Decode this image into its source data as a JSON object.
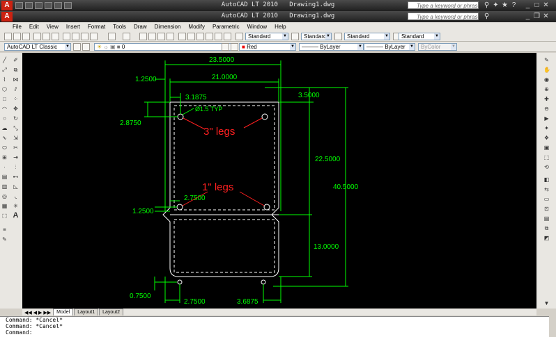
{
  "app": {
    "title": "AutoCAD LT 2010",
    "document": "Drawing1.dwg"
  },
  "search": {
    "placeholder": "Type a keyword or phrase"
  },
  "menu": [
    "File",
    "Edit",
    "View",
    "Insert",
    "Format",
    "Tools",
    "Draw",
    "Dimension",
    "Modify",
    "Parametric",
    "Window",
    "Help"
  ],
  "toolbar": {
    "text_style": "Standard",
    "dim_style": "Standard",
    "table_style": "Standard",
    "mleader_style": "Standard",
    "workspace": "AutoCAD LT Classic",
    "layer": "0",
    "color": "Red",
    "linetype": "ByLayer",
    "lineweight": "ByLayer",
    "plotstyle": "ByColor"
  },
  "drawing": {
    "dims": {
      "overall_width": "23.5000",
      "inner_width": "21.0000",
      "left_offset": "1.2500",
      "hole_offset_x": "3.1875",
      "top_right": "3.5000",
      "hole_offset_y": "2.8750",
      "height_upper": "22.5000",
      "overall_height": "40.5000",
      "hole_x_lower": "2.7500",
      "hole_y_lower": "1.2500",
      "height_lower": "13.0000",
      "bottom_offset": "0.7500",
      "bottom_left": "2.7500",
      "bottom_right": "3.6875"
    },
    "note_hole": "Ø1.5 TYP",
    "label_3in": "3\" legs",
    "label_1in": "1\" legs"
  },
  "layout_tabs": [
    "Model",
    "Layout1",
    "Layout2"
  ],
  "command_lines": [
    "Command: *Cancel*",
    "Command: *Cancel*",
    "Command:"
  ],
  "colors": {
    "canvas": "#000000",
    "dimension": "#00ff00",
    "annotation": "#ff2020",
    "geometry": "#ffffff"
  }
}
